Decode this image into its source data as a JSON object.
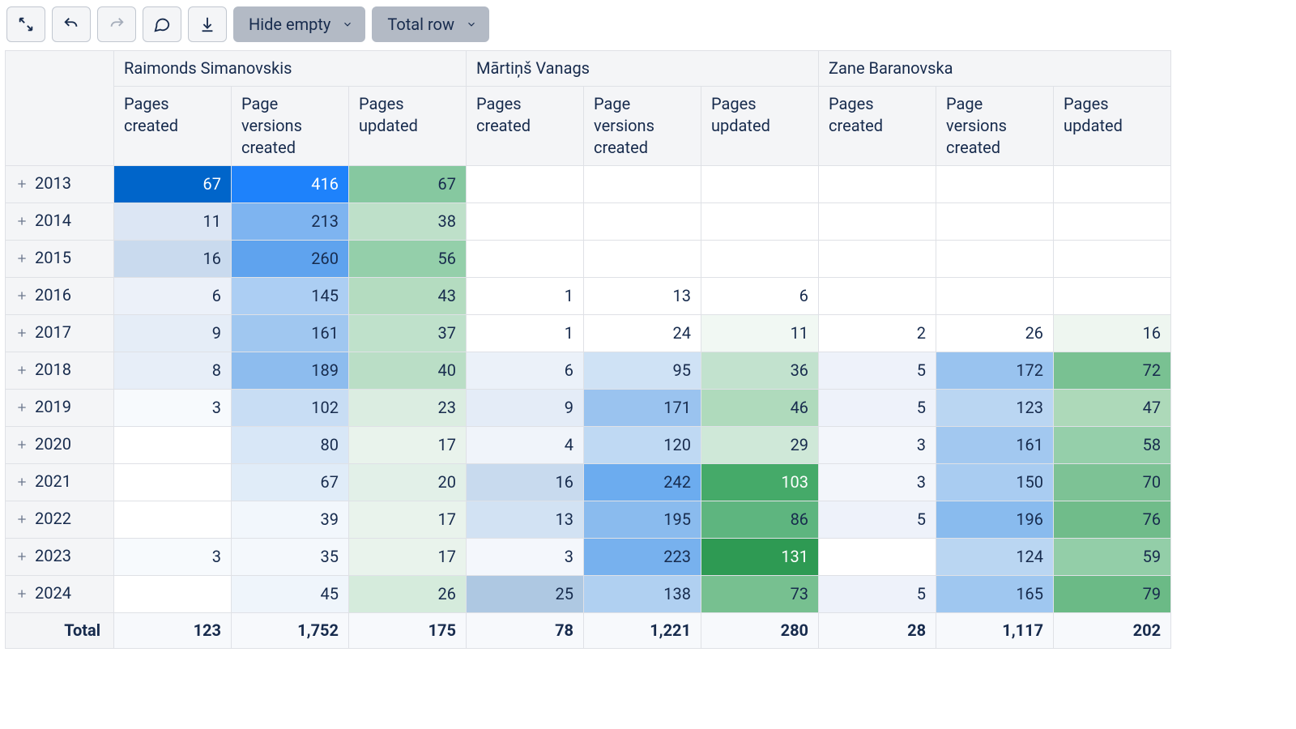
{
  "toolbar": {
    "hide_empty_label": "Hide empty",
    "total_row_label": "Total row"
  },
  "columns": {
    "people": [
      "Raimonds Simanovskis",
      "Mārtiņš Vanags",
      "Zane Baranovska"
    ],
    "metrics": [
      "Pages created",
      "Page versions created",
      "Pages updated"
    ]
  },
  "rows": [
    {
      "year": "2013",
      "cells": [
        {
          "v": "67",
          "bg": "#0065CA",
          "wt": true
        },
        {
          "v": "416",
          "bg": "#1E82FB",
          "wt": true
        },
        {
          "v": "67",
          "bg": "#86C8A0"
        },
        {
          "v": ""
        },
        {
          "v": ""
        },
        {
          "v": ""
        },
        {
          "v": ""
        },
        {
          "v": ""
        },
        {
          "v": ""
        }
      ]
    },
    {
      "year": "2014",
      "cells": [
        {
          "v": "11",
          "bg": "#DCE6F4"
        },
        {
          "v": "213",
          "bg": "#7EB4F0"
        },
        {
          "v": "38",
          "bg": "#BEE0C9"
        },
        {
          "v": ""
        },
        {
          "v": ""
        },
        {
          "v": ""
        },
        {
          "v": ""
        },
        {
          "v": ""
        },
        {
          "v": ""
        }
      ]
    },
    {
      "year": "2015",
      "cells": [
        {
          "v": "16",
          "bg": "#C9DAEE"
        },
        {
          "v": "260",
          "bg": "#5FA3EE"
        },
        {
          "v": "56",
          "bg": "#94CFAA"
        },
        {
          "v": ""
        },
        {
          "v": ""
        },
        {
          "v": ""
        },
        {
          "v": ""
        },
        {
          "v": ""
        },
        {
          "v": ""
        }
      ]
    },
    {
      "year": "2016",
      "cells": [
        {
          "v": "6",
          "bg": "#ECF1F9"
        },
        {
          "v": "145",
          "bg": "#ACCEF3"
        },
        {
          "v": "43",
          "bg": "#B4DCC0"
        },
        {
          "v": "1",
          "bg": ""
        },
        {
          "v": "13",
          "bg": ""
        },
        {
          "v": "6",
          "bg": ""
        },
        {
          "v": ""
        },
        {
          "v": ""
        },
        {
          "v": ""
        }
      ]
    },
    {
      "year": "2017",
      "cells": [
        {
          "v": "9",
          "bg": "#E5EDF7"
        },
        {
          "v": "161",
          "bg": "#A0C7F0"
        },
        {
          "v": "37",
          "bg": "#BFE1CB"
        },
        {
          "v": "1",
          "bg": ""
        },
        {
          "v": "24",
          "bg": ""
        },
        {
          "v": "11",
          "bg": "#F1F8F3"
        },
        {
          "v": "2",
          "bg": ""
        },
        {
          "v": "26",
          "bg": ""
        },
        {
          "v": "16",
          "bg": "#EEF6F0"
        }
      ]
    },
    {
      "year": "2018",
      "cells": [
        {
          "v": "8",
          "bg": "#E7EEF8"
        },
        {
          "v": "189",
          "bg": "#8DBCEE"
        },
        {
          "v": "40",
          "bg": "#BADEC6"
        },
        {
          "v": "6",
          "bg": "#EBF1F9"
        },
        {
          "v": "95",
          "bg": "#CFE2F5"
        },
        {
          "v": "36",
          "bg": "#C2E2CE"
        },
        {
          "v": "5",
          "bg": "#EEF2FA"
        },
        {
          "v": "172",
          "bg": "#99C3EF"
        },
        {
          "v": "72",
          "bg": "#79C192"
        }
      ]
    },
    {
      "year": "2019",
      "cells": [
        {
          "v": "3",
          "bg": "#F7FAFD"
        },
        {
          "v": "102",
          "bg": "#C8DDF4"
        },
        {
          "v": "23",
          "bg": "#DBEDE1"
        },
        {
          "v": "9",
          "bg": "#E4ECF7"
        },
        {
          "v": "171",
          "bg": "#9AC3EF"
        },
        {
          "v": "46",
          "bg": "#AFDABC"
        },
        {
          "v": "5",
          "bg": "#EEF2FA"
        },
        {
          "v": "123",
          "bg": "#BAD6F2"
        },
        {
          "v": "47",
          "bg": "#ADD9B9"
        }
      ]
    },
    {
      "year": "2020",
      "cells": [
        {
          "v": "",
          "bg": ""
        },
        {
          "v": "80",
          "bg": "#D8E7F7"
        },
        {
          "v": "17",
          "bg": "#E9F3EC"
        },
        {
          "v": "4",
          "bg": "#F0F4FA"
        },
        {
          "v": "120",
          "bg": "#BFD9F3"
        },
        {
          "v": "29",
          "bg": "#CFE8D8"
        },
        {
          "v": "3",
          "bg": "#F3F6FB"
        },
        {
          "v": "161",
          "bg": "#A2C8F0"
        },
        {
          "v": "58",
          "bg": "#95CFAA"
        }
      ]
    },
    {
      "year": "2021",
      "cells": [
        {
          "v": "",
          "bg": ""
        },
        {
          "v": "67",
          "bg": "#E0ECF8"
        },
        {
          "v": "20",
          "bg": "#E2F0E8"
        },
        {
          "v": "16",
          "bg": "#C8DAEE"
        },
        {
          "v": "242",
          "bg": "#6CACEF"
        },
        {
          "v": "103",
          "bg": "#45AA69",
          "wt": true
        },
        {
          "v": "3",
          "bg": "#F3F6FB"
        },
        {
          "v": "150",
          "bg": "#A9CCF1"
        },
        {
          "v": "70",
          "bg": "#7DC295"
        }
      ]
    },
    {
      "year": "2022",
      "cells": [
        {
          "v": "",
          "bg": ""
        },
        {
          "v": "39",
          "bg": "#F2F7FC"
        },
        {
          "v": "17",
          "bg": "#E9F3EC"
        },
        {
          "v": "13",
          "bg": "#D2E2F3"
        },
        {
          "v": "195",
          "bg": "#8ABBEE"
        },
        {
          "v": "86",
          "bg": "#5EB57F"
        },
        {
          "v": "5",
          "bg": "#EEF2FA"
        },
        {
          "v": "196",
          "bg": "#89BBEE"
        },
        {
          "v": "76",
          "bg": "#70BC8A"
        }
      ]
    },
    {
      "year": "2023",
      "cells": [
        {
          "v": "3",
          "bg": "#F7FAFD"
        },
        {
          "v": "35",
          "bg": "#F4F8FC"
        },
        {
          "v": "17",
          "bg": "#E9F3EC"
        },
        {
          "v": "3",
          "bg": "#F4F7FC"
        },
        {
          "v": "223",
          "bg": "#77B1EE"
        },
        {
          "v": "131",
          "bg": "#2E9A53",
          "wt": true
        },
        {
          "v": "",
          "bg": ""
        },
        {
          "v": "124",
          "bg": "#BAD6F2"
        },
        {
          "v": "59",
          "bg": "#93CEA8"
        }
      ]
    },
    {
      "year": "2024",
      "cells": [
        {
          "v": "",
          "bg": ""
        },
        {
          "v": "45",
          "bg": "#EFF5FB"
        },
        {
          "v": "26",
          "bg": "#D5EBDC"
        },
        {
          "v": "25",
          "bg": "#AEC8E2"
        },
        {
          "v": "138",
          "bg": "#B0D0F1"
        },
        {
          "v": "73",
          "bg": "#77C090"
        },
        {
          "v": "5",
          "bg": "#EEF2FA"
        },
        {
          "v": "165",
          "bg": "#9FC7F0"
        },
        {
          "v": "79",
          "bg": "#6BBA86"
        }
      ]
    }
  ],
  "totals": {
    "label": "Total",
    "values": [
      "123",
      "1,752",
      "175",
      "78",
      "1,221",
      "280",
      "28",
      "1,117",
      "202"
    ]
  }
}
